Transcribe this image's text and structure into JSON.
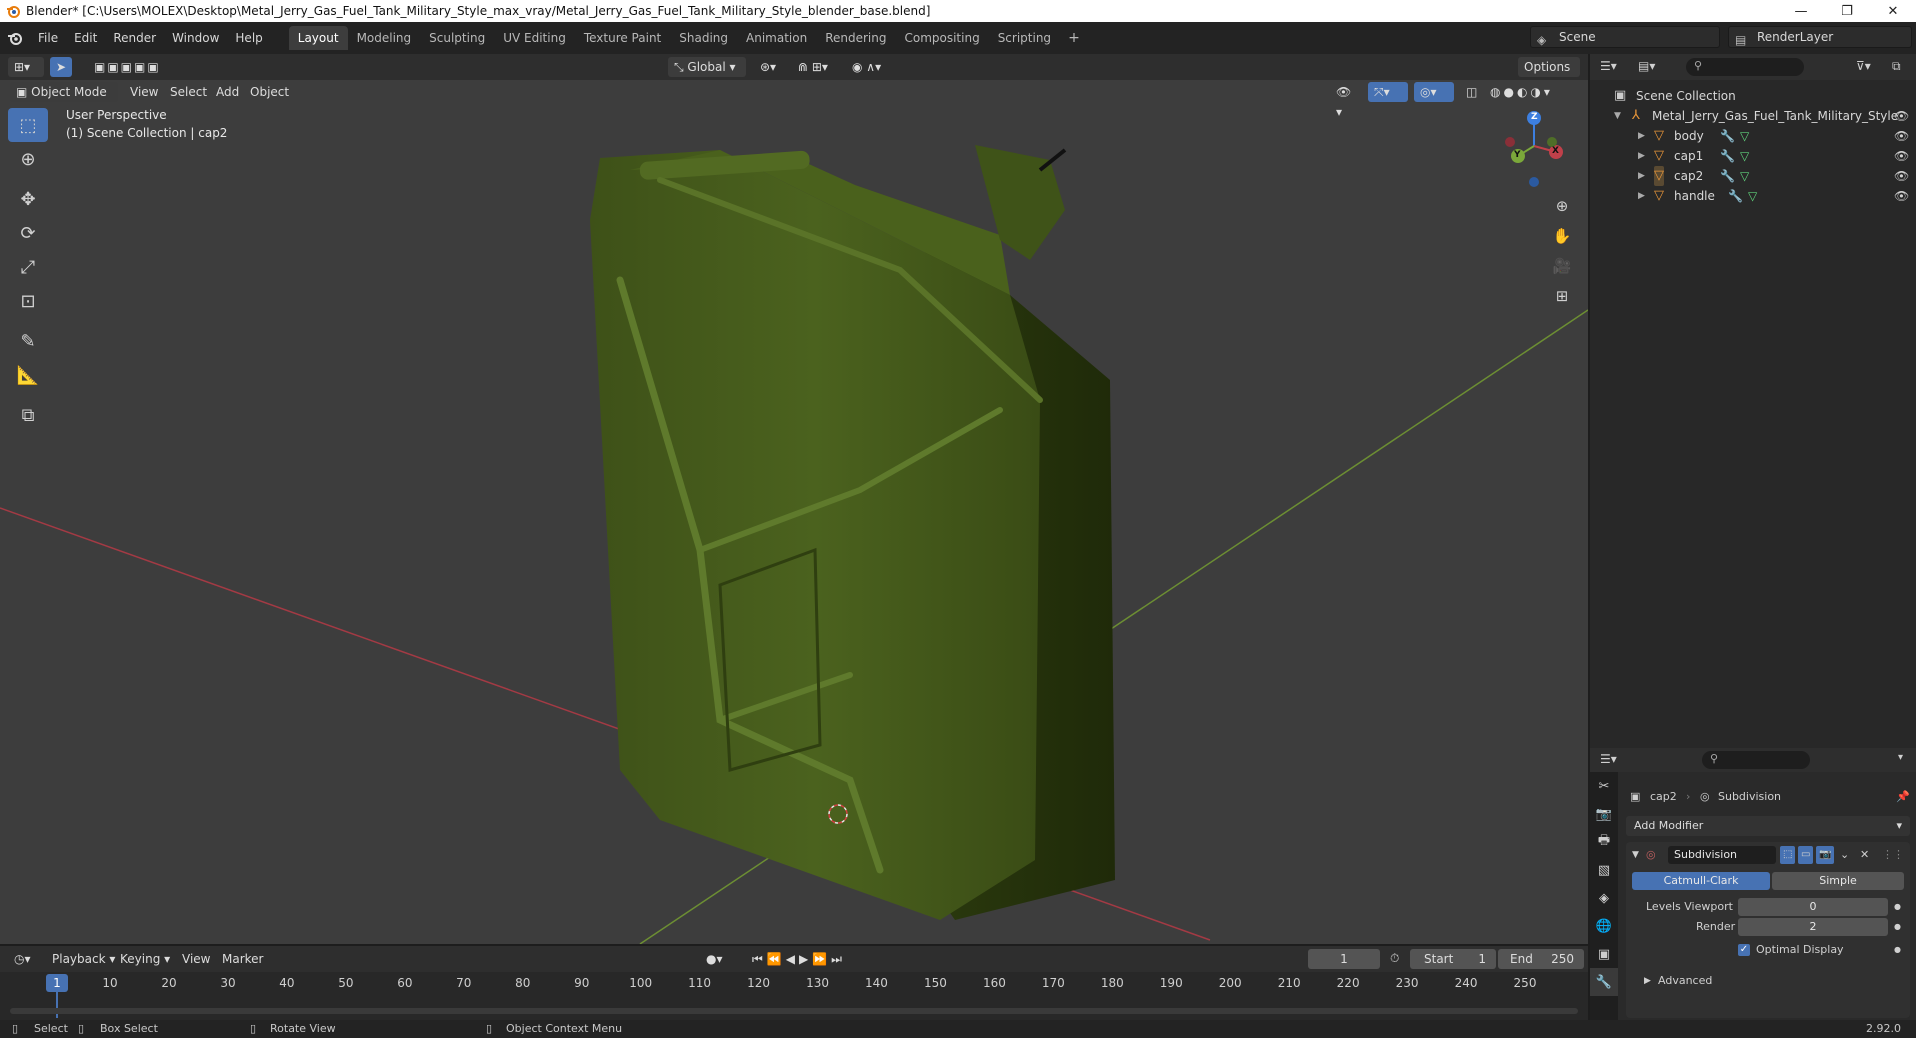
{
  "window": {
    "title": "Blender* [C:\\Users\\MOLEX\\Desktop\\Metal_Jerry_Gas_Fuel_Tank_Military_Style_max_vray/Metal_Jerry_Gas_Fuel_Tank_Military_Style_blender_base.blend]",
    "minimize": "—",
    "maximize": "❐",
    "close": "✕"
  },
  "menu": [
    "File",
    "Edit",
    "Render",
    "Window",
    "Help"
  ],
  "workspaces": [
    "Layout",
    "Modeling",
    "Sculpting",
    "UV Editing",
    "Texture Paint",
    "Shading",
    "Animation",
    "Rendering",
    "Compositing",
    "Scripting"
  ],
  "workspace_add": "+",
  "scene": {
    "name": "Scene",
    "render_layer": "RenderLayer"
  },
  "viewport_header": {
    "transform_orientation": "Global",
    "options": "Options",
    "mode": "Object Mode",
    "menus": [
      "View",
      "Select",
      "Add",
      "Object"
    ]
  },
  "viewport": {
    "perspective": "User Perspective",
    "collection_info": "(1) Scene Collection | cap2",
    "axis_x": "X",
    "axis_y": "Y",
    "axis_z": "Z"
  },
  "outliner": {
    "root": "Scene Collection",
    "collection": "Metal_Jerry_Gas_Fuel_Tank_Military_Style",
    "objects": [
      "body",
      "cap1",
      "cap2",
      "handle"
    ]
  },
  "properties": {
    "object": "cap2",
    "modifier_context": "Subdivision",
    "add_modifier": "Add Modifier",
    "modifier_name": "Subdivision",
    "type_options": [
      "Catmull-Clark",
      "Simple"
    ],
    "levels_viewport_label": "Levels Viewport",
    "levels_viewport": "0",
    "render_label": "Render",
    "render": "2",
    "optimal_display": "Optimal Display",
    "advanced": "Advanced"
  },
  "timeline": {
    "menus": [
      "Playback",
      "Keying",
      "View",
      "Marker"
    ],
    "current_frame": "1",
    "start_label": "Start",
    "start": "1",
    "end_label": "End",
    "end": "250",
    "ticks": [
      "1",
      "10",
      "20",
      "30",
      "40",
      "50",
      "60",
      "70",
      "80",
      "90",
      "100",
      "110",
      "120",
      "130",
      "140",
      "150",
      "160",
      "170",
      "180",
      "190",
      "200",
      "210",
      "220",
      "230",
      "240",
      "250"
    ]
  },
  "statusbar": {
    "select": "Select",
    "box_select": "Box Select",
    "rotate_view": "Rotate View",
    "context_menu": "Object Context Menu",
    "version": "2.92.0"
  },
  "colors": {
    "accent": "#4772b3",
    "object_orange": "#e8963a",
    "tank_green": "#4a5d1c",
    "x_axis": "#c0404a",
    "y_axis": "#7ba83a",
    "z_axis": "#3d7fe0"
  }
}
